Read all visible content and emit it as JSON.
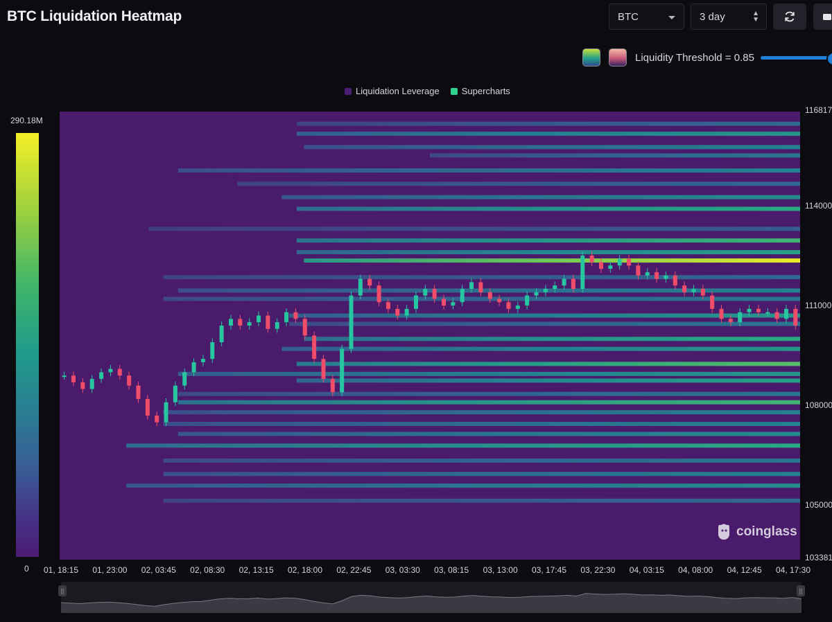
{
  "title": "BTC Liquidation Heatmap",
  "controls": {
    "symbol": "BTC",
    "range": "3 day",
    "threshold_label": "Liquidity Threshold = 0.85",
    "threshold_value": 0.85
  },
  "legend": [
    {
      "label": "Liquidation Leverage",
      "color": "#4a1c72"
    },
    {
      "label": "Supercharts",
      "color": "#2fd28f"
    }
  ],
  "colorbar": {
    "max_label": "290.18M",
    "min_label": "0"
  },
  "y_axis": {
    "labels": [
      "116817",
      "114000",
      "111000",
      "108000",
      "105000",
      "103381"
    ]
  },
  "x_axis": {
    "labels": [
      "01, 18:15",
      "01, 23:00",
      "02, 03:45",
      "02, 08:30",
      "02, 13:15",
      "02, 18:00",
      "02, 22:45",
      "03, 03:30",
      "03, 08:15",
      "03, 13:00",
      "03, 17:45",
      "03, 22:30",
      "04, 03:15",
      "04, 08:00",
      "04, 12:45",
      "04, 17:30"
    ]
  },
  "watermark": "coinglass",
  "chart_data": {
    "type": "heatmap",
    "title": "BTC Liquidation Heatmap",
    "y_range": [
      103381,
      116817
    ],
    "color_scale_range": [
      0,
      290180000
    ],
    "liquidity_bands": [
      {
        "price": 116450,
        "start": 0.32,
        "intensity": 0.35
      },
      {
        "price": 116150,
        "start": 0.32,
        "intensity": 0.55
      },
      {
        "price": 115750,
        "start": 0.33,
        "intensity": 0.45
      },
      {
        "price": 115500,
        "start": 0.5,
        "intensity": 0.4
      },
      {
        "price": 115050,
        "start": 0.16,
        "intensity": 0.45
      },
      {
        "price": 114650,
        "start": 0.24,
        "intensity": 0.35
      },
      {
        "price": 114250,
        "start": 0.3,
        "intensity": 0.5
      },
      {
        "price": 113900,
        "start": 0.32,
        "intensity": 0.65
      },
      {
        "price": 113300,
        "start": 0.12,
        "intensity": 0.3
      },
      {
        "price": 112950,
        "start": 0.32,
        "intensity": 0.7
      },
      {
        "price": 112600,
        "start": 0.32,
        "intensity": 0.6
      },
      {
        "price": 112350,
        "start": 0.33,
        "intensity": 1.0
      },
      {
        "price": 111850,
        "start": 0.14,
        "intensity": 0.35
      },
      {
        "price": 111450,
        "start": 0.16,
        "intensity": 0.45
      },
      {
        "price": 111200,
        "start": 0.14,
        "intensity": 0.4
      },
      {
        "price": 110700,
        "start": 0.31,
        "intensity": 0.55
      },
      {
        "price": 110450,
        "start": 0.31,
        "intensity": 0.4
      },
      {
        "price": 110000,
        "start": 0.33,
        "intensity": 0.65
      },
      {
        "price": 109700,
        "start": 0.3,
        "intensity": 0.55
      },
      {
        "price": 109250,
        "start": 0.32,
        "intensity": 0.75
      },
      {
        "price": 108950,
        "start": 0.16,
        "intensity": 0.55
      },
      {
        "price": 108750,
        "start": 0.32,
        "intensity": 0.6
      },
      {
        "price": 108350,
        "start": 0.16,
        "intensity": 0.4
      },
      {
        "price": 108100,
        "start": 0.16,
        "intensity": 0.7
      },
      {
        "price": 107800,
        "start": 0.14,
        "intensity": 0.45
      },
      {
        "price": 107450,
        "start": 0.14,
        "intensity": 0.45
      },
      {
        "price": 107150,
        "start": 0.16,
        "intensity": 0.5
      },
      {
        "price": 106800,
        "start": 0.09,
        "intensity": 0.65
      },
      {
        "price": 106350,
        "start": 0.14,
        "intensity": 0.4
      },
      {
        "price": 105950,
        "start": 0.14,
        "intensity": 0.45
      },
      {
        "price": 105600,
        "start": 0.09,
        "intensity": 0.5
      },
      {
        "price": 105150,
        "start": 0.14,
        "intensity": 0.35
      }
    ],
    "price_series": [
      108900,
      108700,
      108500,
      108800,
      109000,
      109100,
      108900,
      108600,
      108200,
      107700,
      107500,
      108100,
      108600,
      109000,
      109300,
      109400,
      109900,
      110400,
      110600,
      110400,
      110500,
      110700,
      110300,
      110500,
      110800,
      110600,
      110100,
      109400,
      108800,
      108400,
      109700,
      111300,
      111800,
      111600,
      111100,
      110900,
      110700,
      110900,
      111300,
      111500,
      111200,
      111000,
      111100,
      111500,
      111700,
      111400,
      111200,
      111100,
      110900,
      111000,
      111300,
      111400,
      111500,
      111600,
      111800,
      111500,
      112500,
      112300,
      112100,
      112200,
      112400,
      112200,
      111900,
      112000,
      111800,
      111900,
      111600,
      111400,
      111500,
      111300,
      110900,
      110600,
      110500,
      110800,
      110900,
      110800,
      110800,
      110600,
      110900,
      110400
    ]
  }
}
